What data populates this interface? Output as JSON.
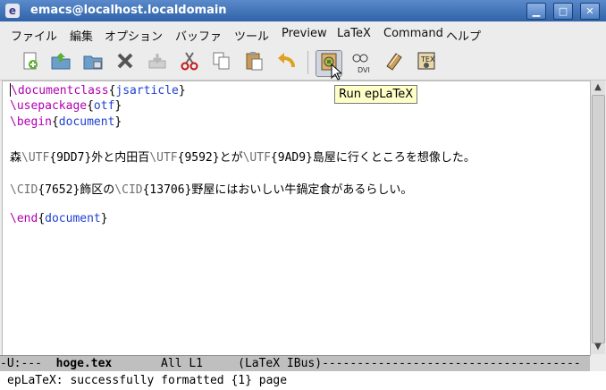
{
  "window": {
    "title": "emacs@localhost.localdomain"
  },
  "titlebar_buttons": {
    "minimize": "▁",
    "maximize": "□",
    "close": "✕"
  },
  "menu": [
    "ファイル",
    "編集",
    "オプション",
    "バッファ",
    "ツール",
    "Preview",
    "LaTeX",
    "Command",
    "ヘルプ"
  ],
  "toolbar": {
    "icons": [
      "new-file-icon",
      "open-folder-icon",
      "dired-folder-icon",
      "close-buffer-icon",
      "save-icon",
      "cut-icon",
      "copy-icon",
      "paste-icon",
      "undo-icon",
      "run-latex-icon",
      "view-dvi-icon",
      "bibtex-icon",
      "tex-quick-icon"
    ],
    "dvi_label": "DVI",
    "tooltip": "Run epLaTeX"
  },
  "editor": {
    "lines": [
      {
        "kw": "\\documentclass",
        "lb": "{",
        "arg": "jsarticle",
        "rb": "}"
      },
      {
        "kw": "\\usepackage",
        "lb": "{",
        "arg": "otf",
        "rb": "}"
      },
      {
        "kw": "\\begin",
        "lb": "{",
        "arg": "document",
        "rb": "}"
      },
      {
        "text": "森\\UTF{9DD7}外と内田百\\UTF{9592}とが\\UTF{9AD9}島屋に行くところを想像した。"
      },
      {
        "text": "\\CID{7652}飾区の\\CID{13706}野屋にはおいしい牛鍋定食があるらしい。"
      },
      {
        "kw": "\\end",
        "lb": "{",
        "arg": "document",
        "rb": "}"
      }
    ],
    "line4": [
      "森",
      "\\UTF",
      "{9DD7}",
      "外と内田百",
      "\\UTF",
      "{9592}",
      "とが",
      "\\UTF",
      "{9AD9}",
      "島屋に行くところを想像した。"
    ],
    "line5": [
      "\\CID",
      "{7652}",
      "飾区の",
      "\\CID",
      "{13706}",
      "野屋にはおいしい牛鍋定食があるらしい。"
    ]
  },
  "modeline": {
    "status": "-U:---  ",
    "buffer": "hoge.tex",
    "position": "       All L1     (LaTeX IBus)",
    "fill": "-------------------------------------"
  },
  "echo": "epLaTeX: successfully formatted {1} page"
}
